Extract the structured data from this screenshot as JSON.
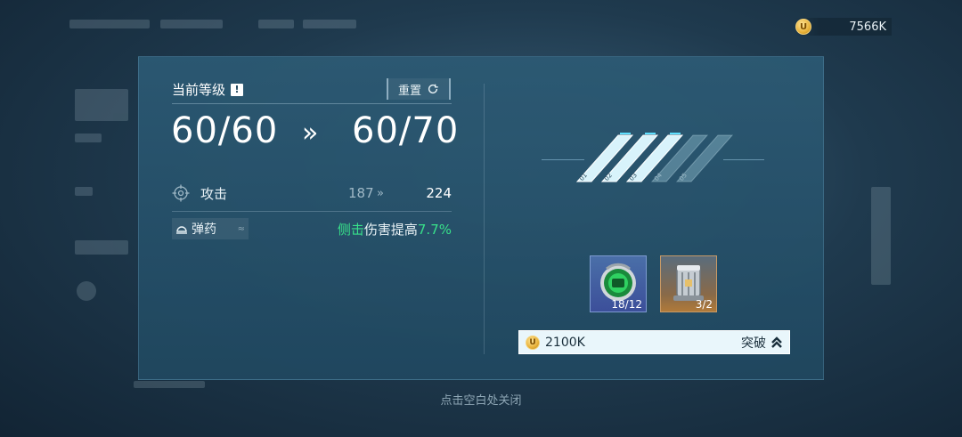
{
  "currency": {
    "icon": "coin-icon",
    "coin_glyph": "U",
    "amount": "7566K"
  },
  "level": {
    "label": "当前等级",
    "warn_glyph": "!",
    "reset_label": "重置",
    "current": "60/60",
    "arrow": "»",
    "next": "60/70"
  },
  "stat": {
    "icon": "crosshair-icon",
    "name": "攻击",
    "old": "187",
    "arrow": "»",
    "new": "224"
  },
  "ammo": {
    "icon": "ammo-icon",
    "label": "弹药",
    "chevron": "≈",
    "bonus_highlight": "侧击",
    "bonus_text": "伤害提高",
    "bonus_pct": "7.7%"
  },
  "ranks": {
    "labels": [
      "01",
      "02",
      "03",
      "04",
      "05"
    ],
    "active_count": 3
  },
  "materials": [
    {
      "icon": "green-core-icon",
      "count": "18/12"
    },
    {
      "icon": "canister-icon",
      "count": "3/2"
    }
  ],
  "breakthrough": {
    "cost": "2100K",
    "label": "突破",
    "coin_glyph": "U"
  },
  "close_hint": "点击空白处关闭",
  "colors": {
    "accent_green": "#38e08a",
    "panel": "#2c5a74",
    "coin": "#e8b23a"
  }
}
